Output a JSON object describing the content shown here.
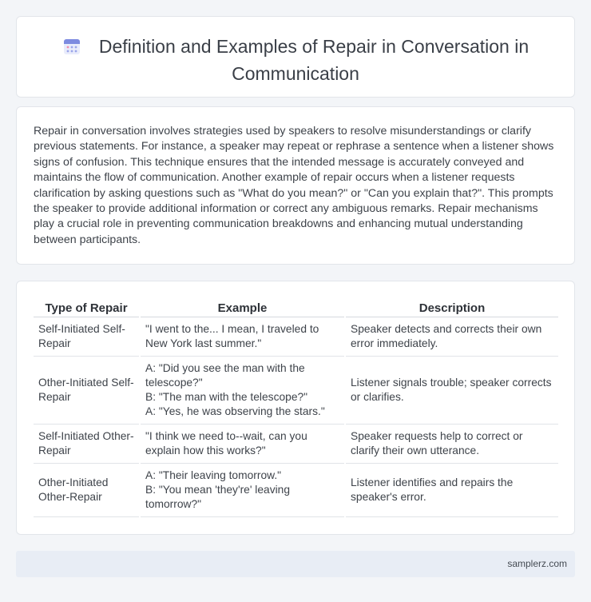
{
  "header": {
    "title": "Definition and Examples of Repair in Conversation in Communication",
    "icon": "calendar-icon",
    "icon_color": "#6b7bd6"
  },
  "intro": {
    "text": "Repair in conversation involves strategies used by speakers to resolve misunderstandings or clarify previous statements. For instance, a speaker may repeat or rephrase a sentence when a listener shows signs of confusion. This technique ensures that the intended message is accurately conveyed and maintains the flow of communication. Another example of repair occurs when a listener requests clarification by asking questions such as \"What do you mean?\" or \"Can you explain that?\". This prompts the speaker to provide additional information or correct any ambiguous remarks. Repair mechanisms play a crucial role in preventing communication breakdowns and enhancing mutual understanding between participants."
  },
  "table": {
    "headers": [
      "Type of Repair",
      "Example",
      "Description"
    ],
    "rows": [
      {
        "type": "Self-Initiated Self-Repair",
        "example": [
          "\"I went to the... I mean, I traveled to New York last summer.\""
        ],
        "description": "Speaker detects and corrects their own error immediately."
      },
      {
        "type": "Other-Initiated Self-Repair",
        "example": [
          "A: \"Did you see the man with the telescope?\"",
          "B: \"The man with the telescope?\"",
          "A: \"Yes, he was observing the stars.\""
        ],
        "description": "Listener signals trouble; speaker corrects or clarifies."
      },
      {
        "type": "Self-Initiated Other-Repair",
        "example": [
          "\"I think we need to--wait, can you explain how this works?\""
        ],
        "description": "Speaker requests help to correct or clarify their own utterance."
      },
      {
        "type": "Other-Initiated Other-Repair",
        "example": [
          "A: \"Their leaving tomorrow.\"",
          "B: \"You mean 'they're' leaving tomorrow?\""
        ],
        "description": "Listener identifies and repairs the speaker's error."
      }
    ]
  },
  "footer": {
    "site": "samplerz.com"
  }
}
